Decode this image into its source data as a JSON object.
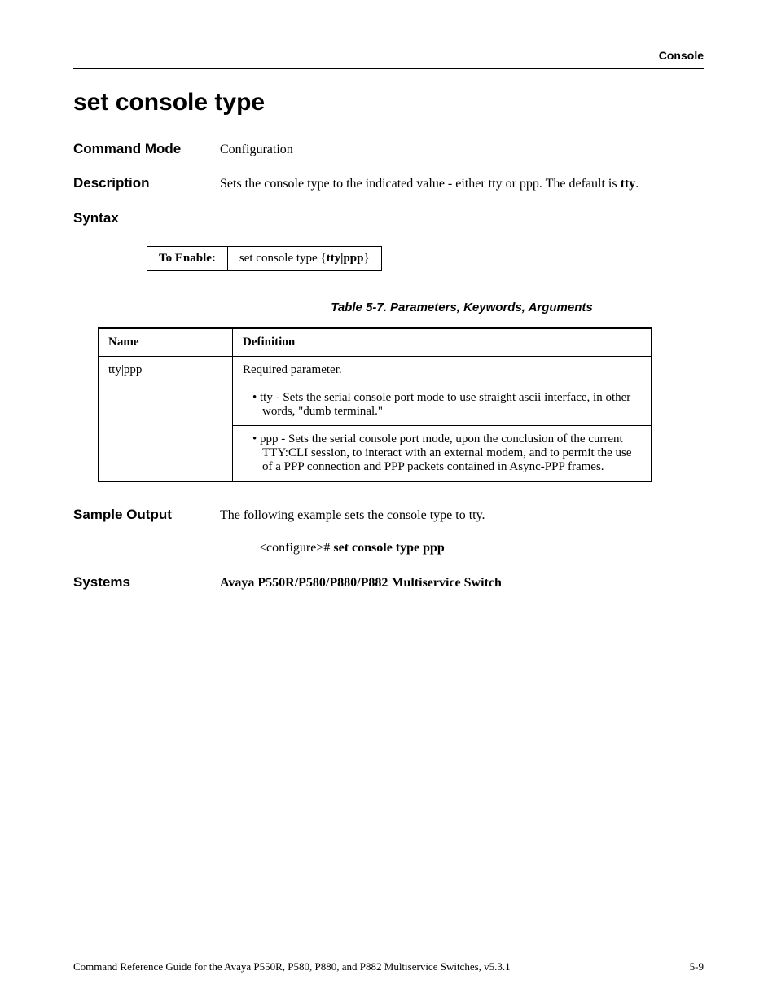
{
  "header": {
    "section": "Console"
  },
  "title": "set console type",
  "command_mode": {
    "label": "Command Mode",
    "value": "Configuration"
  },
  "description": {
    "label": "Description",
    "text_pre": "Sets the console type to the indicated value - either tty or ppp. The default is ",
    "bold": "tty",
    "text_post": "."
  },
  "syntax": {
    "label": "Syntax",
    "enable_label": "To Enable:",
    "enable_pre": "set console type {",
    "enable_bold": "tty|ppp",
    "enable_post": "}"
  },
  "table_caption": "Table 5-7.  Parameters, Keywords, Arguments",
  "param_table": {
    "head_name": "Name",
    "head_def": "Definition",
    "row_name": "tty|ppp",
    "required": "Required parameter.",
    "bullet1": "• tty - Sets the serial console port mode to use straight ascii interface, in other words, \"dumb terminal.\"",
    "bullet2": "• ppp - Sets the serial console port mode, upon the conclusion of the current TTY:CLI session, to interact with an external modem, and to permit the use of a PPP connection and PPP packets contained in Async-PPP frames."
  },
  "sample_output": {
    "label": "Sample Output",
    "intro": "The following example sets the console type to tty.",
    "example_pre": "<configure># ",
    "example_bold": "set console type ppp"
  },
  "systems": {
    "label": "Systems",
    "value": "Avaya P550R/P580/P880/P882 Multiservice Switch"
  },
  "footer": {
    "left": "Command Reference Guide for the Avaya P550R, P580, P880, and P882 Multiservice Switches, v5.3.1",
    "right": "5-9"
  }
}
